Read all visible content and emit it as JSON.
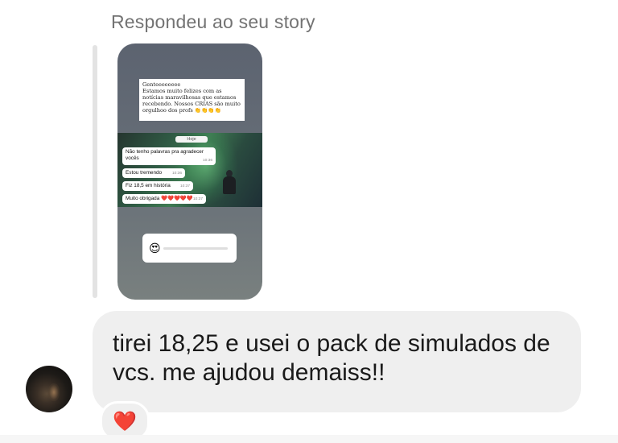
{
  "header": {
    "text": "Respondeu ao seu story"
  },
  "story": {
    "note": "Genteeeeeeee\nEstamos muito felizes com as notícias maravilhosas que estamos recebendo. Nossos CRIAS são muito orgulhoo dos profs 👏👏👏👏",
    "chat_date": "Hoje",
    "messages": [
      {
        "text": "Não tenho palavras pra agradecer vocês",
        "time": "10:36"
      },
      {
        "text": "Estou tremendo",
        "time": "10:36"
      },
      {
        "text": "Fiz 18,5 em história",
        "time": "10:37"
      },
      {
        "text": "Muito obrigada ❤️❤️❤️❤️❤️",
        "time": "10:37"
      }
    ],
    "slider": {
      "emoji": "😍",
      "level": 0
    }
  },
  "message": {
    "text": "tirei 18,25 e usei o pack de simulados de vcs. me ajudou demaiss!!"
  },
  "reaction": {
    "emoji": "❤️"
  },
  "colors": {
    "bubble": "#efefef",
    "header_text": "#737373"
  }
}
